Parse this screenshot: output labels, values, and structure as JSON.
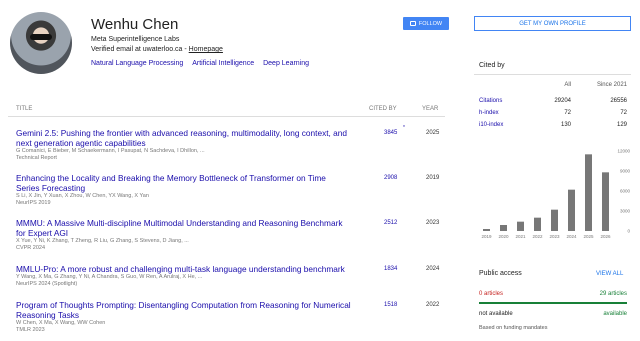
{
  "profile": {
    "name": "Wenhu Chen",
    "affiliation": "Meta Superintelligence Labs",
    "verified_prefix": "Verified email at uwaterloo.ca - ",
    "homepage": "Homepage",
    "interests": [
      "Natural Language Processing",
      "Artificial Intelligence",
      "Deep Learning"
    ]
  },
  "actions": {
    "follow": "FOLLOW",
    "get_profile": "GET MY OWN PROFILE"
  },
  "table": {
    "headers": {
      "title": "TITLE",
      "cited_by": "CITED BY",
      "year": "YEAR"
    },
    "rows": [
      {
        "title": "Gemini 2.5: Pushing the frontier with advanced reasoning, multimodality, long context, and next generation agentic capabilities",
        "authors": "G Comanici, E Bieber, M Schaekermann, I Pasupat, N Sachdeva, I Dhillon, ...",
        "venue": "Technical Report",
        "cited": "3845",
        "star": "*",
        "year": "2025"
      },
      {
        "title": "Enhancing the Locality and Breaking the Memory Bottleneck of Transformer on Time Series Forecasting",
        "authors": "S Li, X Jin, Y Xuan, X Zhou, W Chen, YX Wang, X Yan",
        "venue": "NeurIPS 2019",
        "cited": "2908",
        "star": "",
        "year": "2019"
      },
      {
        "title": "MMMU: A Massive Multi-discipline Multimodal Understanding and Reasoning Benchmark for Expert AGI",
        "authors": "X Yue, Y Ni, K Zhang, T Zheng, R Liu, G Zhang, S Stevens, D Jiang, ...",
        "venue": "CVPR 2024",
        "cited": "2512",
        "star": "",
        "year": "2023"
      },
      {
        "title": "MMLU-Pro: A more robust and challenging multi-task language understanding benchmark",
        "authors": "Y Wang, X Ma, G Zhang, Y Ni, A Chandra, S Guo, W Ren, A Arulraj, X He, ...",
        "venue": "NeurIPS 2024 (Spotlight)",
        "cited": "1834",
        "star": "",
        "year": "2024"
      },
      {
        "title": "Program of Thoughts Prompting: Disentangling Computation from Reasoning for Numerical Reasoning Tasks",
        "authors": "W Chen, X Ma, X Wang, WW Cohen",
        "venue": "TMLR 2023",
        "cited": "1518",
        "star": "",
        "year": "2022"
      }
    ]
  },
  "cited_by": {
    "heading": "Cited by",
    "columns": [
      "All",
      "Since 2021"
    ],
    "stats": [
      {
        "label": "Citations",
        "all": "29204",
        "since": "26556"
      },
      {
        "label": "h-index",
        "all": "72",
        "since": "72"
      },
      {
        "label": "i10-index",
        "all": "130",
        "since": "129"
      }
    ]
  },
  "chart_data": {
    "type": "bar",
    "categories": [
      "2019",
      "2020",
      "2021",
      "2022",
      "2023",
      "2024",
      "2025",
      "2026"
    ],
    "values": [
      300,
      900,
      1400,
      2000,
      3200,
      6200,
      11500,
      8800
    ],
    "y_ticks": [
      "12000",
      "9000",
      "6000",
      "3000",
      "0"
    ],
    "ylim": [
      0,
      12000
    ],
    "grid": false
  },
  "public_access": {
    "heading": "Public access",
    "view_all": "VIEW ALL",
    "rows": [
      {
        "label": "0 articles",
        "value": "29 articles",
        "label_color": "#c5221f",
        "value_color": "#188038"
      },
      {
        "label": "not available",
        "value": "available",
        "label_color": "#222222",
        "value_color": "#188038"
      }
    ],
    "funding": "Based on funding mandates"
  }
}
